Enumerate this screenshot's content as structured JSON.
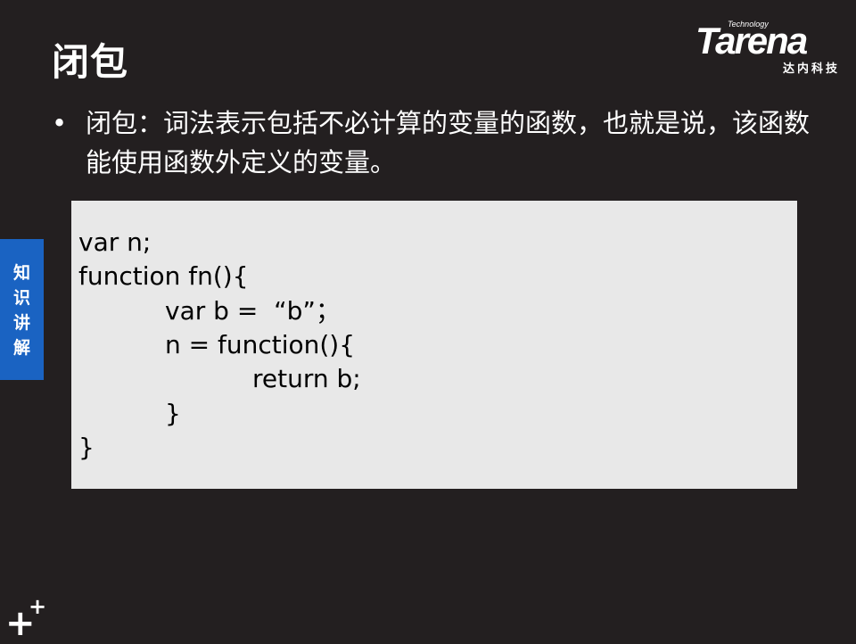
{
  "slide": {
    "title": "闭包",
    "bullet_marker": "•",
    "bullet_text": "闭包：词法表示包括不必计算的变量的函数，也就是说，该函数能使用函数外定义的变量。"
  },
  "logo": {
    "tagline": "Technology",
    "wordmark": "Tarena",
    "subtitle": "达内科技"
  },
  "side_tab": {
    "label": "知识讲解"
  },
  "code": {
    "lines": [
      "var n;",
      "function fn(){",
      "var b =  “b”；",
      "n = function(){",
      "return b;",
      "}",
      "}"
    ]
  },
  "footer": {
    "mark_icon": "plus-plus-icon",
    "big_plus": "+",
    "small_plus": "+"
  },
  "colors": {
    "background": "#231f20",
    "code_background": "#e8e8e8",
    "side_tab": "#1a63c2"
  }
}
